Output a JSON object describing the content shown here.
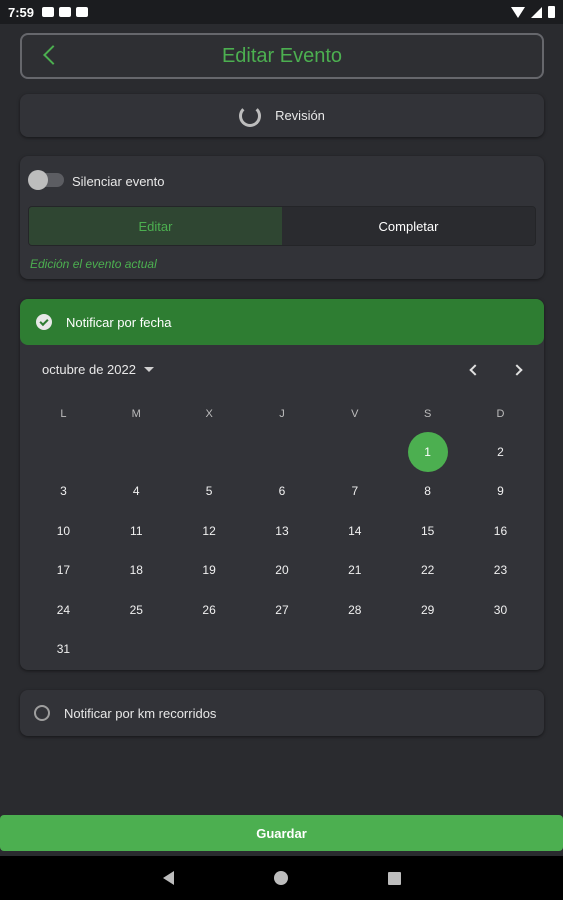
{
  "status_bar": {
    "time": "7:59"
  },
  "header": {
    "title": "Editar Evento"
  },
  "review": {
    "label": "Revisión"
  },
  "silence": {
    "label": "Silenciar evento",
    "toggle_on": false,
    "segments": [
      "Editar",
      "Completar"
    ],
    "active_segment": "Editar",
    "hint": "Edición el evento actual"
  },
  "date_notify": {
    "label": "Notificar por fecha",
    "checked": true,
    "month_label": "octubre de 2022",
    "weekdays": [
      "L",
      "M",
      "X",
      "J",
      "V",
      "S",
      "D"
    ],
    "weeks": [
      [
        "",
        "",
        "",
        "",
        "",
        "1",
        "2"
      ],
      [
        "3",
        "4",
        "5",
        "6",
        "7",
        "8",
        "9"
      ],
      [
        "10",
        "11",
        "12",
        "13",
        "14",
        "15",
        "16"
      ],
      [
        "17",
        "18",
        "19",
        "20",
        "21",
        "22",
        "23"
      ],
      [
        "24",
        "25",
        "26",
        "27",
        "28",
        "29",
        "30"
      ],
      [
        "31",
        "",
        "",
        "",
        "",
        "",
        ""
      ]
    ],
    "selected_day": "1"
  },
  "km_notify": {
    "label": "Notificar por km recorridos",
    "checked": false
  },
  "save_button": {
    "label": "Guardar"
  },
  "colors": {
    "accent": "#4caf50",
    "accent_dark": "#2e7d32",
    "background": "#2a2b2f",
    "card": "#323338"
  }
}
